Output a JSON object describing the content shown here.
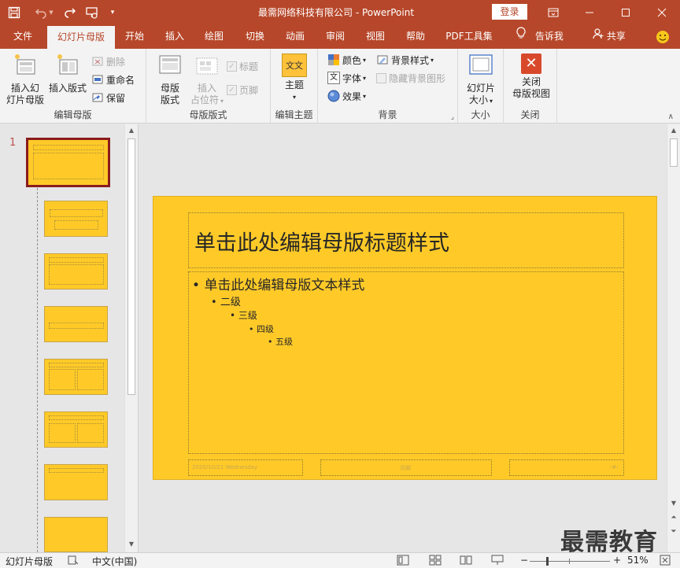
{
  "window": {
    "title": "最需网络科技有限公司 - PowerPoint",
    "login_label": "登录"
  },
  "tabs": [
    {
      "label": "文件"
    },
    {
      "label": "幻灯片母版"
    },
    {
      "label": "开始"
    },
    {
      "label": "插入"
    },
    {
      "label": "绘图"
    },
    {
      "label": "切换"
    },
    {
      "label": "动画"
    },
    {
      "label": "审阅"
    },
    {
      "label": "视图"
    },
    {
      "label": "帮助"
    },
    {
      "label": "PDF工具集"
    },
    {
      "label": "告诉我"
    },
    {
      "label": "共享"
    }
  ],
  "ribbon": {
    "edit_master": {
      "label": "编辑母版",
      "insert_master": "插入幻\n灯片母版",
      "insert_layout": "插入版式",
      "delete": "删除",
      "rename": "重命名",
      "preserve": "保留"
    },
    "master_layout": {
      "label": "母版版式",
      "master_layout_btn": "母版\n版式",
      "insert_placeholder": "插入\n占位符",
      "title_chk": "标题",
      "footer_chk": "页脚"
    },
    "edit_theme": {
      "label": "编辑主题",
      "theme": "主题",
      "theme_icon_text": "文文"
    },
    "background": {
      "label": "背景",
      "colors": "颜色",
      "fonts": "字体",
      "effects": "效果",
      "bg_styles": "背景样式",
      "hide_bg": "隐藏背景图形"
    },
    "size": {
      "label": "大小",
      "slide_size": "幻灯片\n大小"
    },
    "close": {
      "label": "关闭",
      "close_master": "关闭\n母版视图"
    }
  },
  "thumbs": {
    "first_number": "1"
  },
  "slide": {
    "title": "单击此处编辑母版标题样式",
    "level1": "单击此处编辑母版文本样式",
    "level2": "二级",
    "level3": "三级",
    "level4": "四级",
    "level5": "五级",
    "date": "2020/10/21 Wednesday",
    "footer": "页脚",
    "page_num": "‹#›"
  },
  "status": {
    "view": "幻灯片母版",
    "language": "中文(中国)",
    "zoom": "51%"
  },
  "watermark": "最需教育",
  "colors": {
    "accent": "#b7472a",
    "slide_bg": "#ffca28",
    "selected_thumb_border": "#8a1c1c"
  }
}
